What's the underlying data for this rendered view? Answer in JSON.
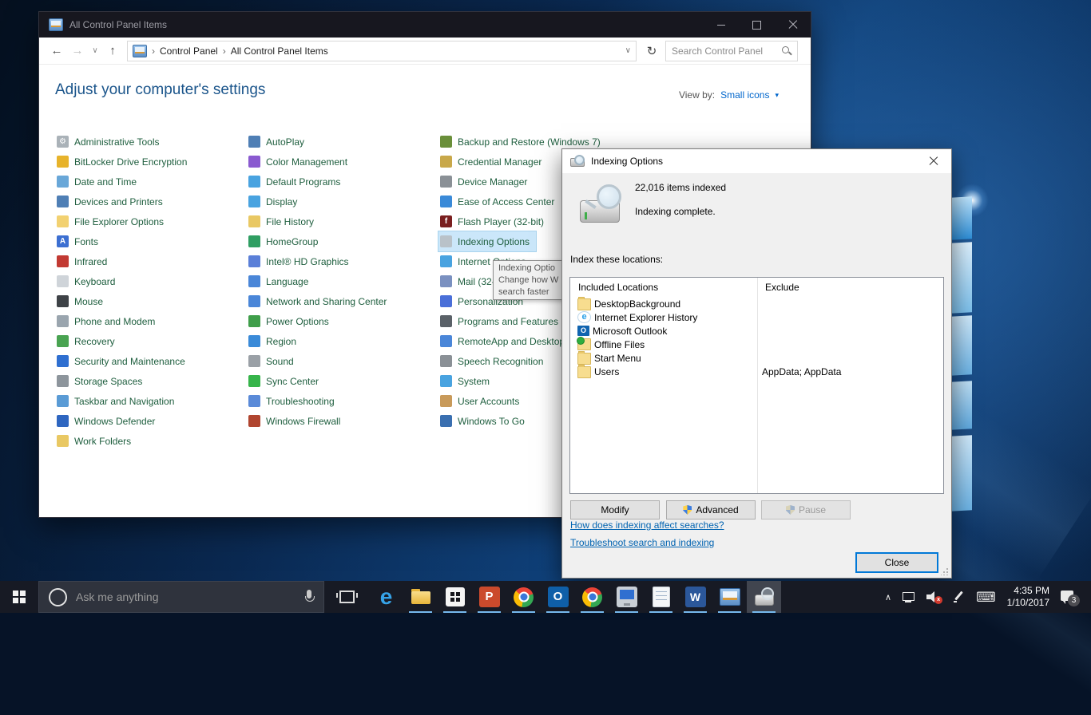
{
  "icons": {
    "back": "←",
    "forward": "→",
    "caret_small": "∨",
    "up": "↑",
    "refresh": "↻",
    "caret_down": "▾",
    "crumb_sep": "›",
    "chevron_up": "∧",
    "keyboard_glyph": "⌨"
  },
  "control_panel": {
    "title": "All Control Panel Items",
    "breadcrumb": [
      "Control Panel",
      "All Control Panel Items"
    ],
    "search_placeholder": "Search Control Panel",
    "header": "Adjust your computer's settings",
    "view_by_label": "View by:",
    "view_by_value": "Small icons",
    "columns": [
      [
        {
          "label": "Administrative Tools",
          "icon": "administrative-tools-icon",
          "color": "#aab2b8",
          "glyph": "⚙"
        },
        {
          "label": "BitLocker Drive Encryption",
          "icon": "bitlocker-icon",
          "color": "#e7b32b"
        },
        {
          "label": "Date and Time",
          "icon": "date-and-time-icon",
          "color": "#69a7d8"
        },
        {
          "label": "Devices and Printers",
          "icon": "devices-and-printers-icon",
          "color": "#4f7fb5"
        },
        {
          "label": "File Explorer Options",
          "icon": "file-explorer-options-icon",
          "color": "#f2d171"
        },
        {
          "label": "Fonts",
          "icon": "fonts-icon",
          "color": "#3c6fd1",
          "glyph": "A"
        },
        {
          "label": "Infrared",
          "icon": "infrared-icon",
          "color": "#c23a33"
        },
        {
          "label": "Keyboard",
          "icon": "keyboard-icon",
          "color": "#cfd4d9"
        },
        {
          "label": "Mouse",
          "icon": "mouse-icon",
          "color": "#3e4247"
        },
        {
          "label": "Phone and Modem",
          "icon": "phone-and-modem-icon",
          "color": "#9aa5ae"
        },
        {
          "label": "Recovery",
          "icon": "recovery-icon",
          "color": "#49a351"
        },
        {
          "label": "Security and Maintenance",
          "icon": "security-and-maintenance-icon",
          "color": "#2f6fd0"
        },
        {
          "label": "Storage Spaces",
          "icon": "storage-spaces-icon",
          "color": "#8d959c"
        },
        {
          "label": "Taskbar and Navigation",
          "icon": "taskbar-and-navigation-icon",
          "color": "#5a9bd5"
        },
        {
          "label": "Windows Defender",
          "icon": "windows-defender-icon",
          "color": "#2e66c0"
        },
        {
          "label": "Work Folders",
          "icon": "work-folders-icon",
          "color": "#e9c863"
        }
      ],
      [
        {
          "label": "AutoPlay",
          "icon": "autoplay-icon",
          "color": "#4f7fb5"
        },
        {
          "label": "Color Management",
          "icon": "color-management-icon",
          "color": "#8a5ad0"
        },
        {
          "label": "Default Programs",
          "icon": "default-programs-icon",
          "color": "#49a3e0"
        },
        {
          "label": "Display",
          "icon": "display-icon",
          "color": "#49a3e0"
        },
        {
          "label": "File History",
          "icon": "file-history-icon",
          "color": "#e9c863"
        },
        {
          "label": "HomeGroup",
          "icon": "homegroup-icon",
          "color": "#2f9e62"
        },
        {
          "label": "Intel® HD Graphics",
          "icon": "intel-hd-graphics-icon",
          "color": "#5a7fd8"
        },
        {
          "label": "Language",
          "icon": "language-icon",
          "color": "#4a86d8"
        },
        {
          "label": "Network and Sharing Center",
          "icon": "network-and-sharing-center-icon",
          "color": "#4a86d8"
        },
        {
          "label": "Power Options",
          "icon": "power-options-icon",
          "color": "#3f9e4a"
        },
        {
          "label": "Region",
          "icon": "region-icon",
          "color": "#3a8ad8"
        },
        {
          "label": "Sound",
          "icon": "sound-icon",
          "color": "#9aa0a6"
        },
        {
          "label": "Sync Center",
          "icon": "sync-center-icon",
          "color": "#36b44a"
        },
        {
          "label": "Troubleshooting",
          "icon": "troubleshooting-icon",
          "color": "#5a8ad8"
        },
        {
          "label": "Windows Firewall",
          "icon": "windows-firewall-icon",
          "color": "#b0452f"
        }
      ],
      [
        {
          "label": "Backup and Restore (Windows 7)",
          "icon": "backup-and-restore-icon",
          "color": "#6a8f3a"
        },
        {
          "label": "Credential Manager",
          "icon": "credential-manager-icon",
          "color": "#c8a84a"
        },
        {
          "label": "Device Manager",
          "icon": "device-manager-icon",
          "color": "#8a9096"
        },
        {
          "label": "Ease of Access Center",
          "icon": "ease-of-access-center-icon",
          "color": "#3a8ad8"
        },
        {
          "label": "Flash Player (32-bit)",
          "icon": "flash-player-icon",
          "color": "#7a1f1f",
          "glyph": "f"
        },
        {
          "label": "Indexing Options",
          "icon": "indexing-options-icon",
          "color": "#b9c2c9",
          "highlight": true
        },
        {
          "label": "Internet Options",
          "icon": "internet-options-icon",
          "color": "#49a3e0"
        },
        {
          "label": "Mail (32-bit)",
          "icon": "mail-icon",
          "color": "#7a90c0"
        },
        {
          "label": "Personalization",
          "icon": "personalization-icon",
          "color": "#4a6fd8"
        },
        {
          "label": "Programs and Features",
          "icon": "programs-and-features-icon",
          "color": "#5a6168"
        },
        {
          "label": "RemoteApp and Desktop Connections",
          "icon": "remoteapp-icon",
          "color": "#4a86d8"
        },
        {
          "label": "Speech Recognition",
          "icon": "speech-recognition-icon",
          "color": "#8a9096"
        },
        {
          "label": "System",
          "icon": "system-icon",
          "color": "#49a3e0"
        },
        {
          "label": "User Accounts",
          "icon": "user-accounts-icon",
          "color": "#c89a5a"
        },
        {
          "label": "Windows To Go",
          "icon": "windows-to-go-icon",
          "color": "#3a6fb0"
        }
      ]
    ]
  },
  "tooltip": {
    "line1": "Indexing Optio",
    "line2": "Change how W",
    "line3": "search faster"
  },
  "dialog": {
    "title": "Indexing Options",
    "items_indexed": "22,016 items indexed",
    "status": "Indexing complete.",
    "locations_label": "Index these locations:",
    "columns": {
      "included": "Included Locations",
      "exclude": "Exclude"
    },
    "rows": [
      {
        "name": "DesktopBackground",
        "icon": "folder-icon",
        "kind": "folder",
        "exclude": ""
      },
      {
        "name": "Internet Explorer History",
        "icon": "internet-explorer-icon",
        "kind": "ie",
        "glyph": "e",
        "exclude": ""
      },
      {
        "name": "Microsoft Outlook",
        "icon": "outlook-icon",
        "kind": "outlook",
        "glyph": "O",
        "exclude": ""
      },
      {
        "name": "Offline Files",
        "icon": "offline-files-icon",
        "kind": "offline",
        "exclude": ""
      },
      {
        "name": "Start Menu",
        "icon": "folder-icon",
        "kind": "folder",
        "exclude": ""
      },
      {
        "name": "Users",
        "icon": "folder-icon",
        "kind": "folder",
        "exclude": "AppData; AppData"
      }
    ],
    "buttons": {
      "modify": "Modify",
      "advanced": "Advanced",
      "pause": "Pause",
      "close": "Close"
    },
    "links": [
      "How does indexing affect searches?",
      "Troubleshoot search and indexing"
    ]
  },
  "taskbar": {
    "search_placeholder": "Ask me anything",
    "apps": [
      {
        "name": "Microsoft Edge",
        "icon": "edge-icon",
        "kind": "edge",
        "glyph": "e",
        "underline": false,
        "active": false
      },
      {
        "name": "File Explorer",
        "icon": "file-explorer-icon",
        "kind": "folder",
        "underline": true,
        "active": false
      },
      {
        "name": "Windows Store",
        "icon": "store-icon",
        "kind": "store",
        "underline": true,
        "active": false
      },
      {
        "name": "PowerPoint",
        "icon": "powerpoint-icon",
        "kind": "ppt",
        "glyph": "P",
        "underline": true,
        "active": false
      },
      {
        "name": "Chrome",
        "icon": "chrome-icon",
        "kind": "chrome",
        "underline": true,
        "active": false
      },
      {
        "name": "Outlook",
        "icon": "outlook-icon",
        "kind": "outlook",
        "glyph": "O",
        "underline": true,
        "active": false
      },
      {
        "name": "Chrome",
        "icon": "chrome-icon",
        "kind": "chrome",
        "underline": true,
        "active": false
      },
      {
        "name": "Remote Desktop",
        "icon": "remote-desktop-icon",
        "kind": "pc",
        "underline": true,
        "active": false
      },
      {
        "name": "Notepad",
        "icon": "notepad-icon",
        "kind": "notepad",
        "underline": true,
        "active": false
      },
      {
        "name": "Word",
        "icon": "word-icon",
        "kind": "word",
        "glyph": "W",
        "underline": true,
        "active": false
      },
      {
        "name": "Control Panel",
        "icon": "control-panel-icon",
        "kind": "cpl",
        "underline": true,
        "active": false
      },
      {
        "name": "Indexing Options",
        "icon": "indexing-options-icon",
        "kind": "indexing",
        "underline": true,
        "active": true
      }
    ],
    "tray": {
      "time": "4:35 PM",
      "date": "1/10/2017",
      "badge": "3"
    }
  }
}
